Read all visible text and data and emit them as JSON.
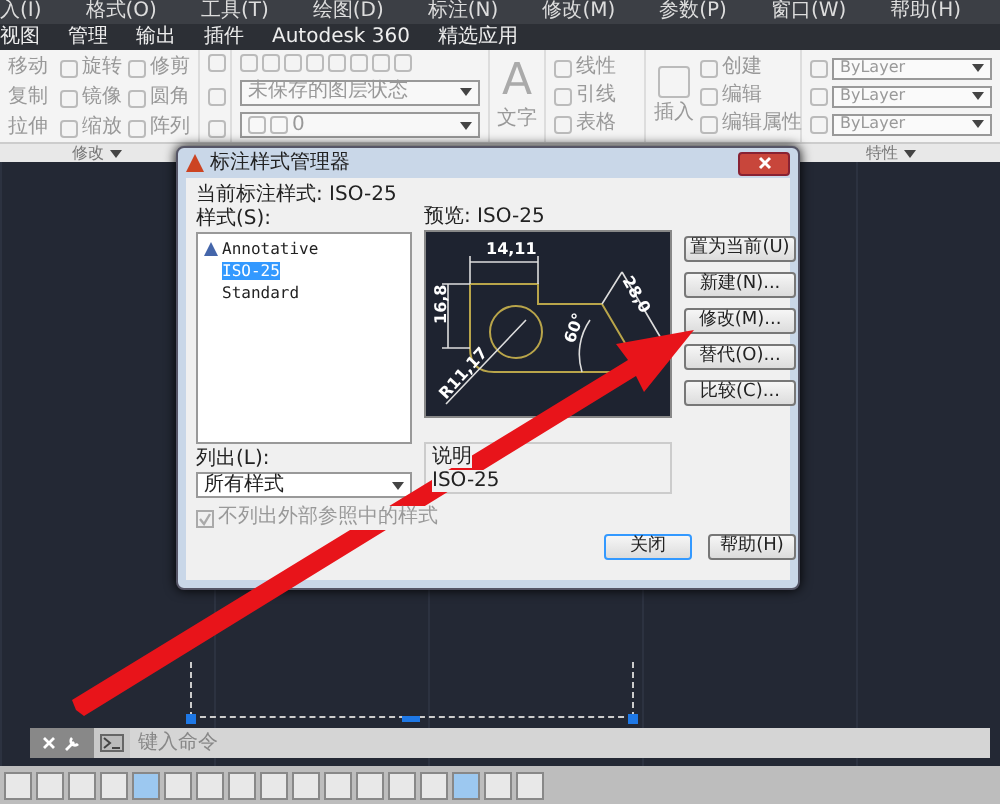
{
  "menu_bar": [
    "入(I)",
    "格式(O)",
    "工具(T)",
    "绘图(D)",
    "标注(N)",
    "修改(M)",
    "参数(P)",
    "窗口(W)",
    "帮助(H)"
  ],
  "ribbon_tabs": [
    "视图",
    "管理",
    "输出",
    "插件",
    "Autodesk 360",
    "精选应用"
  ],
  "ribbon": {
    "modify_tools": [
      "移动",
      "旋转",
      "修剪",
      "复制",
      "镜像",
      "圆角",
      "拉伸",
      "缩放",
      "阵列"
    ],
    "layer_state": "未保存的图层状态",
    "layer_name": "0",
    "text_glyph": "A",
    "text_tool": "文字",
    "annotation_tools": [
      "线性",
      "引线",
      "表格"
    ],
    "block_insert": "插入",
    "block_tools": [
      "创建",
      "编辑",
      "编辑属性"
    ],
    "properties": [
      "ByLayer",
      "ByLayer",
      "ByLayer"
    ],
    "panel_labels": [
      "修改",
      "特性"
    ]
  },
  "dialog": {
    "title": "标注样式管理器",
    "current_style": "当前标注样式: ISO-25",
    "styles_label": "样式(S):",
    "styles": [
      {
        "name": "Annotative",
        "kind": "annotative",
        "selected": false
      },
      {
        "name": "ISO-25",
        "kind": "plain",
        "selected": true
      },
      {
        "name": "Standard",
        "kind": "plain",
        "selected": false
      }
    ],
    "preview_label": "预览: ISO-25",
    "preview_dims": [
      "14,11",
      "16,8",
      "28,0",
      "60°",
      "R11,17"
    ],
    "list_label": "列出(L):",
    "list_value": "所有样式",
    "exclude_xref": {
      "label": "不列出外部参照中的样式",
      "checked": true,
      "disabled": true
    },
    "description_label": "说明",
    "description": "ISO-25",
    "buttons": [
      "置为当前(U)",
      "新建(N)...",
      "修改(M)...",
      "替代(O)...",
      "比较(C)..."
    ],
    "footer_buttons": [
      "关闭",
      "帮助(H)"
    ]
  },
  "command_line": {
    "placeholder": "键入命令"
  }
}
